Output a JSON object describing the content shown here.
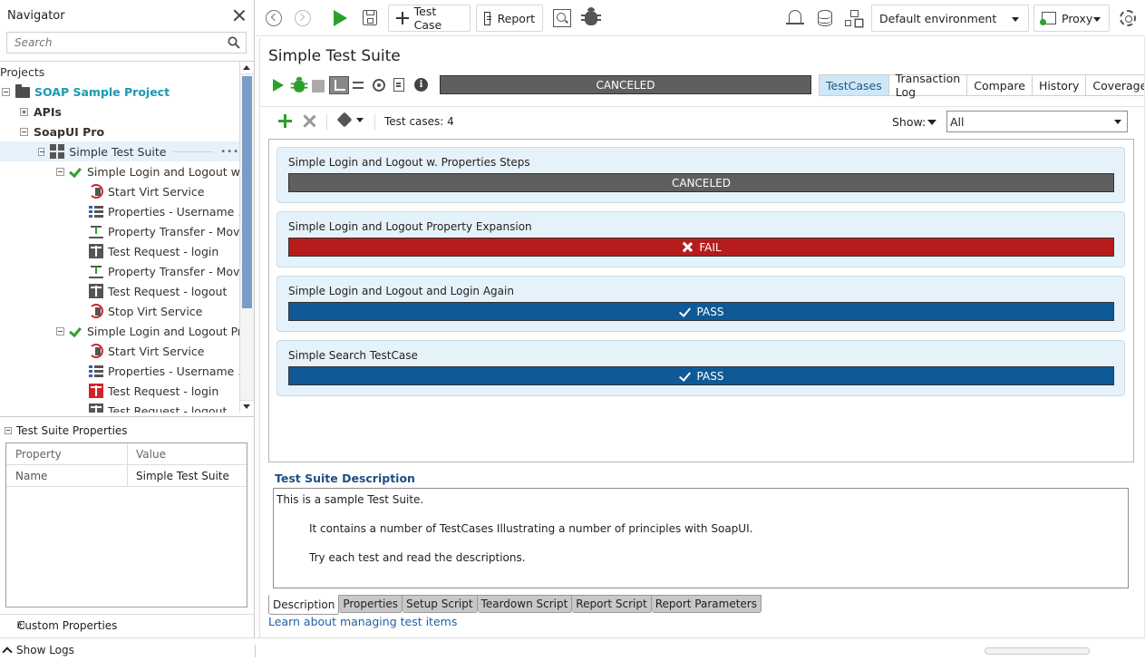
{
  "navigator": {
    "title": "Navigator",
    "search_placeholder": "Search",
    "projects_label": "Projects",
    "tree": [
      {
        "label": "SOAP Sample Project",
        "icon": "folder-icon",
        "kind": "project"
      },
      {
        "label": "APIs",
        "icon": "expand-icon",
        "kind": "group"
      },
      {
        "label": "SoapUI Pro",
        "icon": "collapse-icon",
        "kind": "group"
      },
      {
        "label": "Simple Test Suite",
        "icon": "test-suite-icon",
        "kind": "suite"
      },
      {
        "label": "Simple Login and Logout w. ...",
        "icon": "pass-check-icon",
        "kind": "case"
      },
      {
        "label": "Start Virt Service",
        "icon": "virt-service-icon",
        "kind": "step"
      },
      {
        "label": "Properties - Username ...",
        "icon": "properties-icon",
        "kind": "step"
      },
      {
        "label": "Property Transfer - Mov...",
        "icon": "property-transfer-icon",
        "kind": "step"
      },
      {
        "label": "Test Request - login",
        "icon": "test-request-icon",
        "kind": "step"
      },
      {
        "label": "Property Transfer - Mov...",
        "icon": "property-transfer-icon",
        "kind": "step"
      },
      {
        "label": "Test Request - logout",
        "icon": "test-request-icon",
        "kind": "step"
      },
      {
        "label": "Stop Virt Service",
        "icon": "virt-service-icon",
        "kind": "step"
      },
      {
        "label": "Simple Login and Logout Pr...",
        "icon": "pass-check-icon",
        "kind": "case"
      },
      {
        "label": "Start Virt Service",
        "icon": "virt-service-icon",
        "kind": "step"
      },
      {
        "label": "Properties - Username ...",
        "icon": "properties-icon",
        "kind": "step"
      },
      {
        "label": "Test Request - login",
        "icon": "test-request-error-icon",
        "kind": "step"
      },
      {
        "label": "Test Request - logout",
        "icon": "test-request-icon",
        "kind": "step"
      }
    ],
    "suite_properties": {
      "title": "Test Suite Properties",
      "headers": {
        "property": "Property",
        "value": "Value"
      },
      "rows": [
        {
          "property": "Name",
          "value": "Simple Test Suite"
        }
      ]
    },
    "custom_properties_label": "Custom Properties"
  },
  "toolbar": {
    "test_case_label": "Test Case",
    "report_label": "Report",
    "environment": "Default environment",
    "proxy_label": "Proxy"
  },
  "main": {
    "title": "Simple Test Suite",
    "run_status": "CANCELED",
    "tabs": [
      {
        "label": "TestCases",
        "active": true
      },
      {
        "label": "Transaction Log",
        "active": false
      },
      {
        "label": "Compare",
        "active": false
      },
      {
        "label": "History",
        "active": false
      },
      {
        "label": "Coverage",
        "active": false
      }
    ],
    "test_cases_count": "Test cases: 4",
    "show_label": "Show:",
    "show_value": "All",
    "test_cases": [
      {
        "name": "Simple Login and Logout w. Properties Steps",
        "status": "CANCELED",
        "state": "canceled"
      },
      {
        "name": "Simple Login and Logout Property Expansion",
        "status": "FAIL",
        "state": "fail"
      },
      {
        "name": "Simple Login and Logout and Login Again",
        "status": "PASS",
        "state": "pass"
      },
      {
        "name": "Simple Search TestCase",
        "status": "PASS",
        "state": "pass"
      }
    ],
    "description_title": "Test Suite Description",
    "description_lines": [
      "This is a sample Test Suite.",
      "It contains a number of TestCases Illustrating a number of principles with SoapUI.",
      "Try each test and read the descriptions."
    ],
    "bottom_tabs": [
      {
        "label": "Description",
        "active": true
      },
      {
        "label": "Properties",
        "active": false
      },
      {
        "label": "Setup Script",
        "active": false
      },
      {
        "label": "Teardown Script",
        "active": false
      },
      {
        "label": "Report Script",
        "active": false
      },
      {
        "label": "Report Parameters",
        "active": false
      }
    ],
    "learn_link": "Learn about managing test items"
  },
  "status_bar": {
    "show_logs_label": "Show Logs"
  },
  "colors": {
    "pass": "#0f5a96",
    "fail": "#b71c1c",
    "canceled": "#5f5f5f",
    "accent": "#1e62a8",
    "run_green": "#2ca02c"
  }
}
